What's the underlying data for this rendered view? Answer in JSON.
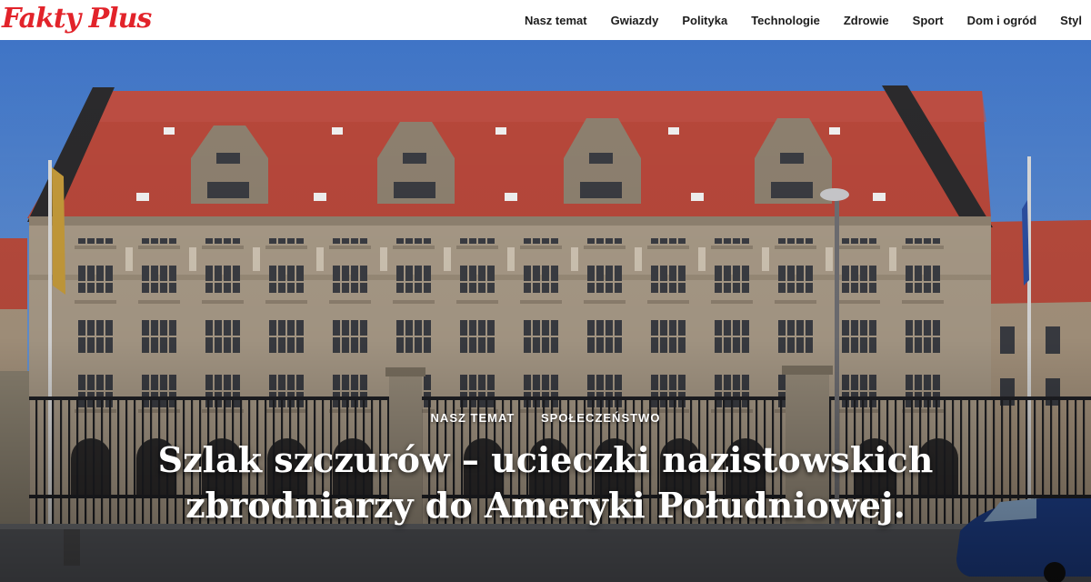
{
  "site": {
    "logo": "Fakty Plus",
    "logo_color": "#e2232a"
  },
  "nav": {
    "items": [
      {
        "label": "Nasz temat"
      },
      {
        "label": "Gwiazdy"
      },
      {
        "label": "Polityka"
      },
      {
        "label": "Technologie"
      },
      {
        "label": "Zdrowie"
      },
      {
        "label": "Sport"
      },
      {
        "label": "Dom i ogród"
      },
      {
        "label": "Styl"
      }
    ]
  },
  "hero": {
    "categories": [
      {
        "label": "NASZ TEMAT"
      },
      {
        "label": "SPOŁECZEŃSTWO"
      }
    ],
    "headline": "Szlak szczurów – ucieczki nazistowskich zbrodniarzy do Ameryki Południowej.",
    "image_subject": "historic-building-photo"
  },
  "colors": {
    "sky": "#4f86d2",
    "roof": "#b8483b",
    "facade": "#a89a87",
    "accent": "#e2232a"
  }
}
